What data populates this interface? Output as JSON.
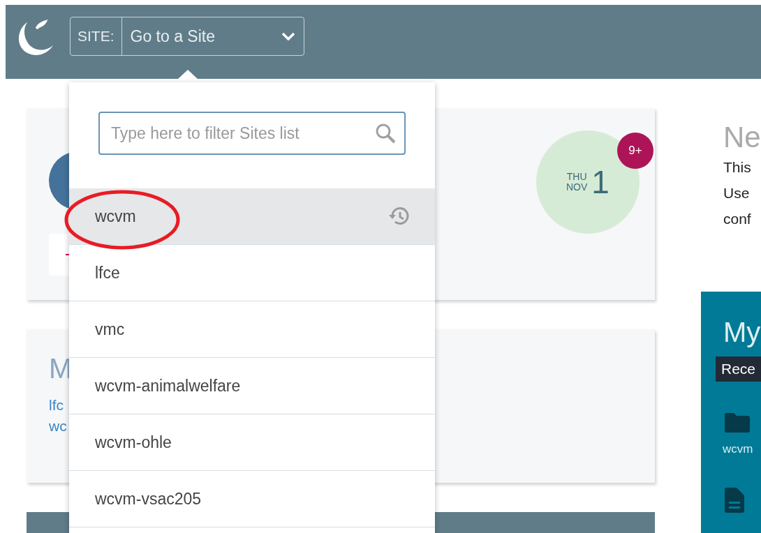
{
  "header": {
    "site_label": "SITE:",
    "site_select": "Go to a Site"
  },
  "calendar": {
    "weekday": "THU",
    "month": "NOV",
    "day": "1",
    "badge": "9+"
  },
  "sites_card": {
    "heading": "M",
    "links": [
      "lfc",
      "wc"
    ]
  },
  "news": {
    "heading": "Ne",
    "lines": [
      "This",
      "Use",
      "conf"
    ]
  },
  "my_panel": {
    "heading": "My",
    "tooltip": "Rece",
    "items": [
      {
        "kind": "folder",
        "label": "wcvm"
      },
      {
        "kind": "document"
      }
    ]
  },
  "dropdown": {
    "search_placeholder": "Type here to filter Sites list",
    "sites": [
      {
        "name": "wcvm",
        "selected": true
      },
      {
        "name": "lfce",
        "selected": false
      },
      {
        "name": "vmc",
        "selected": false
      },
      {
        "name": "wcvm-animalwelfare",
        "selected": false
      },
      {
        "name": "wcvm-ohle",
        "selected": false
      },
      {
        "name": "wcvm-vsac205",
        "selected": false
      }
    ]
  }
}
